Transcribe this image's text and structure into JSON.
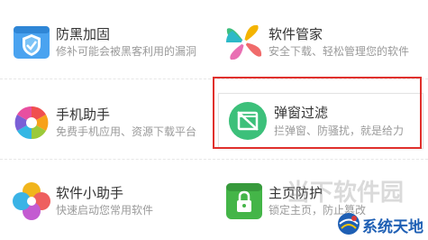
{
  "tiles": [
    {
      "title": "防黑加固",
      "desc": "修补可能会被黑客利用的漏洞",
      "icon": "shield-icon"
    },
    {
      "title": "软件管家",
      "desc": "安全下载、轻松管理您的软件",
      "icon": "pinwheel-icon"
    },
    {
      "title": "手机助手",
      "desc": "免费手机应用、资源下载平台",
      "icon": "rainbow-swirl-icon"
    },
    {
      "title": "弹窗过滤",
      "desc": "拦弹窗、防骚扰，就是给力",
      "icon": "popup-block-icon"
    },
    {
      "title": "软件小助手",
      "desc": "快速启动您常用软件",
      "icon": "clover-icon"
    },
    {
      "title": "主页防护",
      "desc": "锁定主页，防止篡改",
      "icon": "lock-icon"
    }
  ],
  "watermark": {
    "soft_text": "当下软件园",
    "sys_text": "系统天地"
  },
  "colors": {
    "highlight_border": "#e0302c",
    "popup_icon": "#3cc07a",
    "homepage_icon": "#44b548",
    "shield_icon": "#4aa3f0"
  }
}
